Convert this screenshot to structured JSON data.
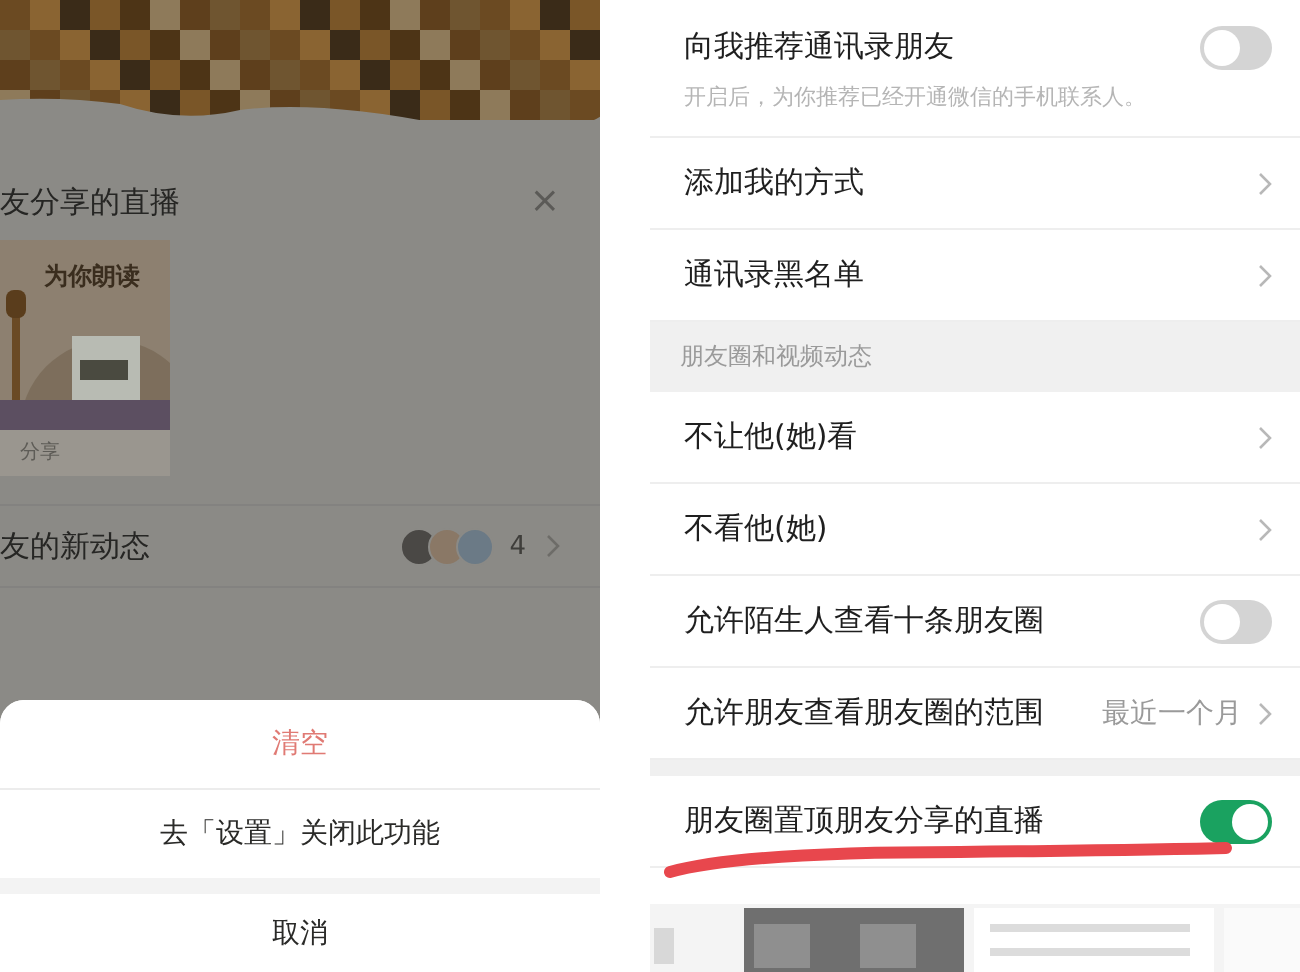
{
  "left": {
    "live_section": {
      "title": "友分享的直播",
      "close": "×",
      "card": {
        "title": "为你朗读",
        "caption": "分享"
      }
    },
    "updates": {
      "label": "友的新动态",
      "count": "4"
    },
    "action_sheet": {
      "items": [
        {
          "label": "清空",
          "kind": "destructive"
        },
        {
          "label": "去「设置」关闭此功能",
          "kind": "normal"
        },
        {
          "label": "取消",
          "kind": "cancel"
        }
      ]
    }
  },
  "settings": {
    "items": [
      {
        "kind": "toggle",
        "label": "向我推荐通讯录朋友",
        "on": false,
        "note": "开启后，为你推荐已经开通微信的手机联系人。"
      },
      {
        "kind": "link",
        "label": "添加我的方式"
      },
      {
        "kind": "link",
        "label": "通讯录黑名单"
      },
      {
        "kind": "header",
        "label": "朋友圈和视频动态"
      },
      {
        "kind": "link",
        "label": "不让他(她)看"
      },
      {
        "kind": "link",
        "label": "不看他(她)"
      },
      {
        "kind": "toggle",
        "label": "允许陌生人查看十条朋友圈",
        "on": false
      },
      {
        "kind": "link",
        "label": "允许朋友查看朋友圈的范围",
        "value": "最近一个月"
      },
      {
        "kind": "spacer"
      },
      {
        "kind": "toggle",
        "label": "朋友圈置顶朋友分享的直播",
        "on": true,
        "underlined": true
      }
    ]
  }
}
